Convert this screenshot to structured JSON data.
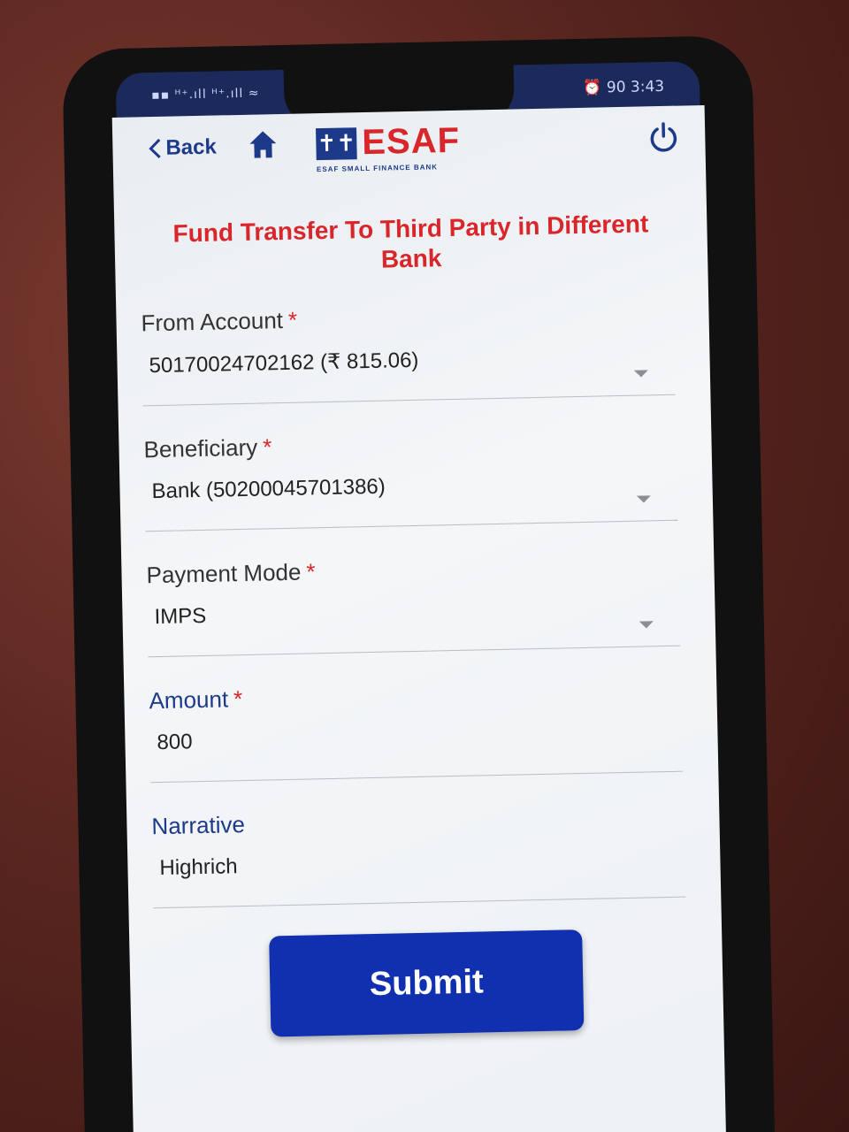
{
  "status_bar": {
    "left": "▪▪ ᴴ⁺.ıll ᴴ⁺.ıll ≈",
    "right": "⏰ 90 3:43"
  },
  "header": {
    "back_label": "Back",
    "logo_text": "ESAF",
    "logo_subtitle": "ESAF SMALL FINANCE BANK",
    "logo_mark": "✝✝"
  },
  "page_title": "Fund Transfer To Third Party in Different Bank",
  "form": {
    "from_account": {
      "label": "From Account",
      "required": "*",
      "value": "50170024702162 (₹ 815.06)"
    },
    "beneficiary": {
      "label": "Beneficiary",
      "required": "*",
      "value": "Bank (50200045701386)"
    },
    "payment_mode": {
      "label": "Payment Mode",
      "required": "*",
      "value": "IMPS"
    },
    "amount": {
      "label": "Amount",
      "required": "*",
      "value": "800"
    },
    "narrative": {
      "label": "Narrative",
      "value": "Highrich"
    }
  },
  "submit_label": "Submit",
  "colors": {
    "brand_red": "#d8262a",
    "brand_blue": "#1d3a8a",
    "button_blue": "#1030b0"
  },
  "icons": [
    "chevron-left-icon",
    "home-icon",
    "power-icon",
    "dropdown-arrow-icon"
  ]
}
